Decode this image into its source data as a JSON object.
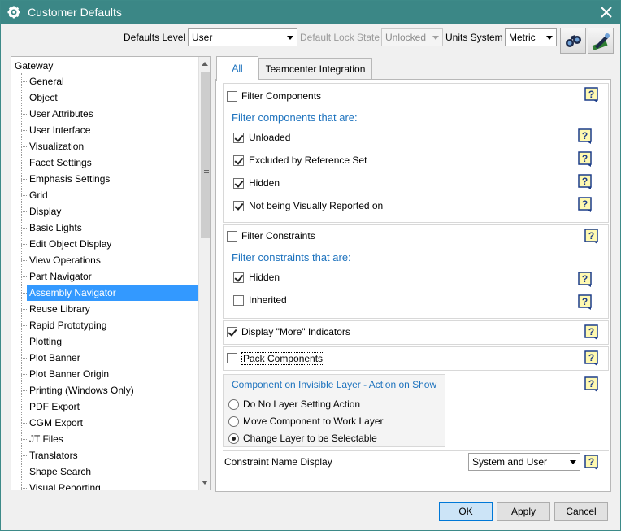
{
  "window": {
    "title": "Customer Defaults"
  },
  "toolbar": {
    "defaults_level_label": "Defaults Level",
    "defaults_level_value": "User",
    "lock_state_label": "Default Lock State",
    "lock_state_value": "Unlocked",
    "units_label": "Units System",
    "units_value": "Metric"
  },
  "tree": {
    "root": "Gateway",
    "items": [
      "General",
      "Object",
      "User Attributes",
      "User Interface",
      "Visualization",
      "Facet Settings",
      "Emphasis Settings",
      "Grid",
      "Display",
      "Basic Lights",
      "Edit Object Display",
      "View Operations",
      "Part Navigator",
      "Assembly Navigator",
      "Reuse Library",
      "Rapid Prototyping",
      "Plotting",
      "Plot Banner",
      "Plot Banner Origin",
      "Printing (Windows Only)",
      "PDF Export",
      "CGM Export",
      "JT Files",
      "Translators",
      "Shape Search",
      "Visual Reporting"
    ],
    "selected": "Assembly Navigator"
  },
  "tabs": [
    "All",
    "Teamcenter Integration"
  ],
  "panel": {
    "filter_components": {
      "label": "Filter Components",
      "checked": false
    },
    "filter_components_header": "Filter components that are:",
    "fc_options": [
      {
        "label": "Unloaded",
        "checked": true
      },
      {
        "label": "Excluded by Reference Set",
        "checked": true
      },
      {
        "label": "Hidden",
        "checked": true
      },
      {
        "label": "Not being Visually Reported on",
        "checked": true
      }
    ],
    "filter_constraints": {
      "label": "Filter Constraints",
      "checked": false
    },
    "filter_constraints_header": "Filter constraints that are:",
    "fcon_options": [
      {
        "label": "Hidden",
        "checked": true
      },
      {
        "label": "Inherited",
        "checked": false
      }
    ],
    "display_more": {
      "label": "Display \"More\" Indicators",
      "checked": true
    },
    "pack_components": {
      "label": "Pack Components",
      "checked": false
    },
    "invisible_layer_header": "Component on Invisible Layer - Action on Show",
    "layer_options": [
      {
        "label": "Do No Layer Setting Action",
        "selected": false
      },
      {
        "label": "Move Component to Work Layer",
        "selected": false
      },
      {
        "label": "Change Layer to be Selectable",
        "selected": true
      }
    ],
    "constraint_name_label": "Constraint Name Display",
    "constraint_name_value": "System and User"
  },
  "buttons": {
    "ok": "OK",
    "apply": "Apply",
    "cancel": "Cancel"
  },
  "colors": {
    "titlebar": "#3b8786",
    "accent": "#1e73be",
    "selection": "#3399ff"
  }
}
